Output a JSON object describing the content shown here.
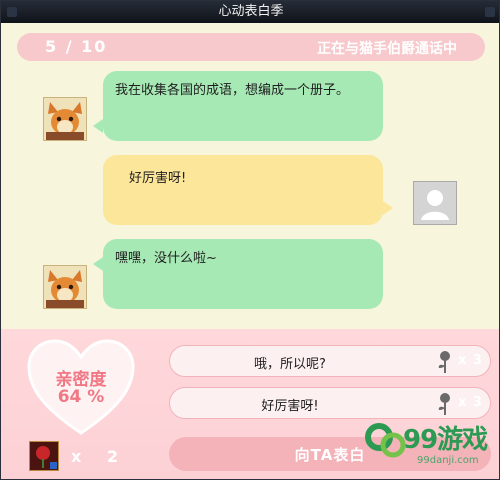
{
  "window": {
    "title": "心动表白季"
  },
  "header": {
    "counter": "5 / 10",
    "status": "正在与猫手伯爵通话中"
  },
  "messages": [
    {
      "side": "left",
      "color": "green",
      "text": "我在收集各国的成语，想编成一个册子。"
    },
    {
      "side": "right",
      "color": "yellow",
      "text": "好厉害呀!"
    },
    {
      "side": "left",
      "color": "green",
      "text": "嘿嘿，没什么啦~"
    }
  ],
  "intimacy": {
    "label": "亲密度",
    "value": "64 %"
  },
  "options": [
    {
      "label": "哦，所以呢?",
      "cost": "x 3"
    },
    {
      "label": "好厉害呀!",
      "cost": "x 3"
    }
  ],
  "confess": {
    "label": "向TA表白"
  },
  "inventory": {
    "count": "x 2"
  },
  "watermark": {
    "text": "99游戏",
    "sub": "99danji.com"
  },
  "colors": {
    "pink": "#f7c9cd",
    "green_bubble": "#a7e9b5",
    "yellow_bubble": "#fbe69a",
    "heart_text": "#f07884"
  }
}
